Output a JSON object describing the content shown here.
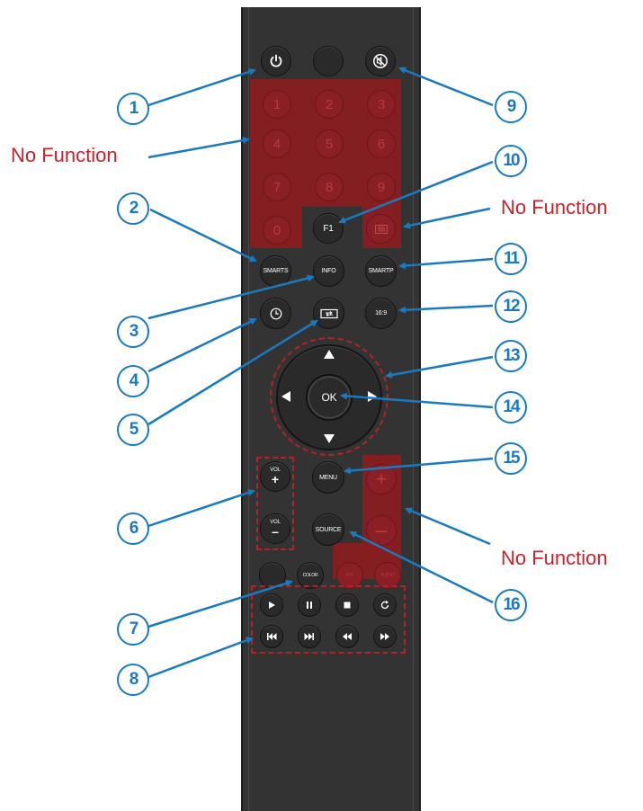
{
  "colors": {
    "remote_body": "#333333",
    "button": "#2a2a2a",
    "no_function_zone": "#8a1c20",
    "callout_blue": "#1a7ac0",
    "label_red": "#c4242b"
  },
  "notes": {
    "no_function": "No Function"
  },
  "buttons": {
    "power": {
      "icon": "power-icon"
    },
    "blank_top": {
      "label": ""
    },
    "mute": {
      "icon": "mute-icon"
    },
    "digits": [
      "1",
      "2",
      "3",
      "4",
      "5",
      "6",
      "7",
      "8",
      "9",
      "0"
    ],
    "f1": "F1",
    "teletext": {
      "icon": "teletext-icon"
    },
    "smarts": "SMARTS",
    "info": "INFO",
    "smartp": "SMARTP",
    "clock": {
      "icon": "clock-icon"
    },
    "input_switch": {
      "icon": "input-switch-icon"
    },
    "aspect": "16:9",
    "ok": "OK",
    "menu": "MENU",
    "source": "SOURCE",
    "vol_up": {
      "label": "VOL",
      "sign": "+"
    },
    "vol_down": {
      "label": "VOL",
      "sign": "–"
    },
    "ch_plus": "+",
    "ch_minus": "–",
    "color": "COLOR",
    "blank_left": {
      "label": ""
    },
    "pip": "PIP",
    "audio": "AUDIO",
    "media": [
      "play-icon",
      "pause-icon",
      "stop-icon",
      "repeat-icon",
      "prev-track-icon",
      "next-track-icon",
      "rewind-icon",
      "fast-forward-icon"
    ]
  },
  "callouts": [
    "1",
    "2",
    "3",
    "4",
    "5",
    "6",
    "7",
    "8",
    "9",
    "10",
    "11",
    "12",
    "13",
    "14",
    "15",
    "16"
  ]
}
